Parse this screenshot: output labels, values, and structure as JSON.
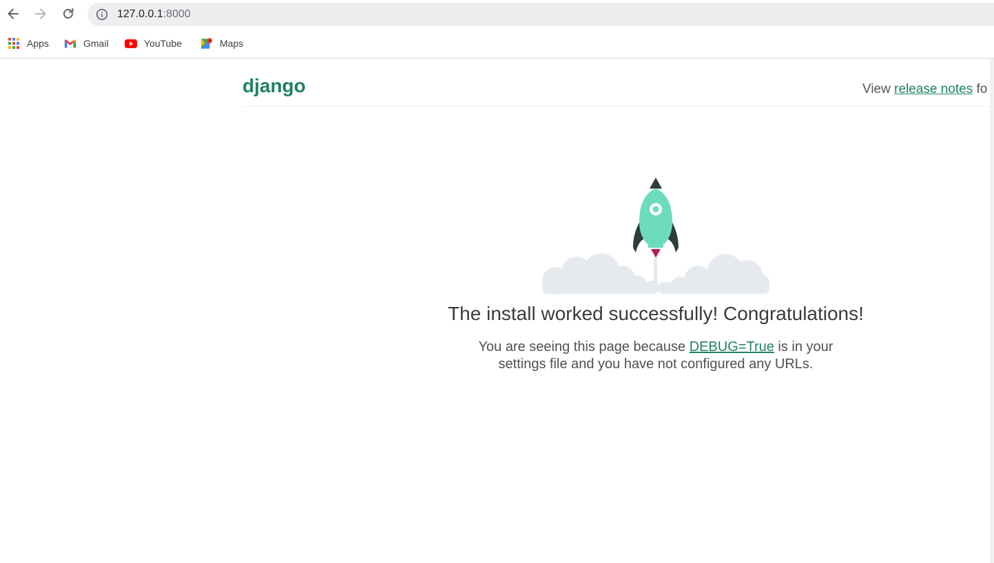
{
  "browser": {
    "url_host": "127.0.0.1",
    "url_port": ":8000",
    "bookmarks": [
      {
        "label": "Apps",
        "icon": "apps-grid-icon"
      },
      {
        "label": "Gmail",
        "icon": "gmail-icon"
      },
      {
        "label": "YouTube",
        "icon": "youtube-icon"
      },
      {
        "label": "Maps",
        "icon": "maps-icon"
      }
    ]
  },
  "header": {
    "logo": "django",
    "release_prefix": "View ",
    "release_link": "release notes",
    "release_suffix": " fo"
  },
  "main": {
    "headline": "The install worked successfully! Congratulations!",
    "sub_before": "You are seeing this page because ",
    "sub_link": "DEBUG=True",
    "sub_mid": " is in your",
    "sub_after": "settings file and you have not configured any URLs."
  },
  "colors": {
    "brand_green": "#20825f",
    "rocket_body": "#6ddcbd",
    "rocket_dark": "#2c3e3a",
    "flame": "#b51e4e",
    "cloud": "#e6e9ee"
  }
}
